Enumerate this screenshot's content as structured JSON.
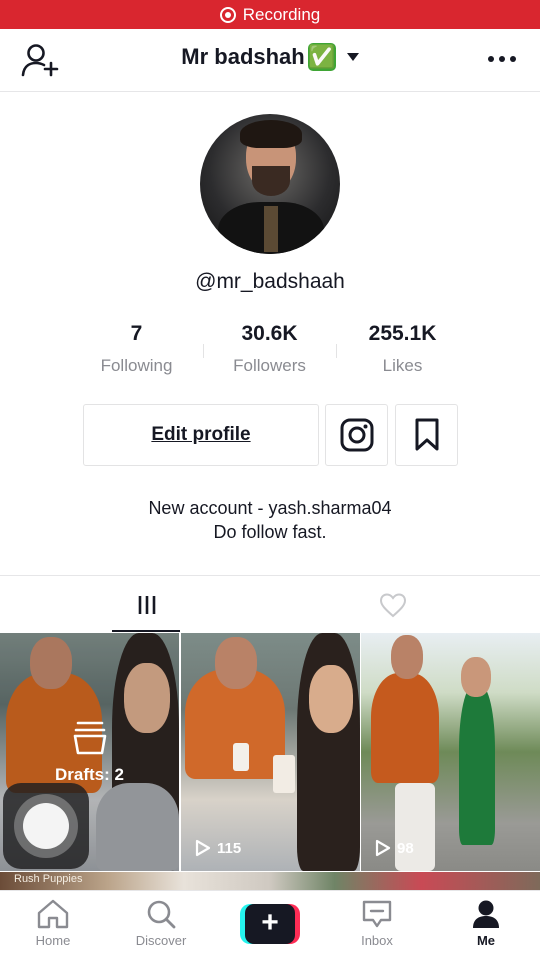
{
  "status_bar": {
    "recording_label": "Recording"
  },
  "header": {
    "username": "Mr badshah",
    "verified_emoji": "✅"
  },
  "profile": {
    "handle": "@mr_badshaah",
    "stats": [
      {
        "value": "7",
        "label": "Following"
      },
      {
        "value": "30.6K",
        "label": "Followers"
      },
      {
        "value": "255.1K",
        "label": "Likes"
      }
    ],
    "edit_profile_label": "Edit profile",
    "bio_lines": [
      "New account - yash.sharma04",
      "Do follow fast."
    ]
  },
  "videos": [
    {
      "drafts_label": "Drafts: 2"
    },
    {
      "views": "115"
    },
    {
      "views": "98"
    }
  ],
  "strip_text": "Rush Puppies",
  "bottom_nav": [
    {
      "label": "Home",
      "icon": "home-icon"
    },
    {
      "label": "Discover",
      "icon": "search-icon"
    },
    {
      "label": "",
      "icon": "plus-icon"
    },
    {
      "label": "Inbox",
      "icon": "inbox-icon"
    },
    {
      "label": "Me",
      "icon": "person-icon"
    }
  ],
  "colors": {
    "recording": "#d9262f",
    "verified": "#3fa535",
    "create_cyan": "#25f4ee",
    "create_pink": "#fe2c55",
    "text": "#161823",
    "muted": "#8a8b91"
  }
}
